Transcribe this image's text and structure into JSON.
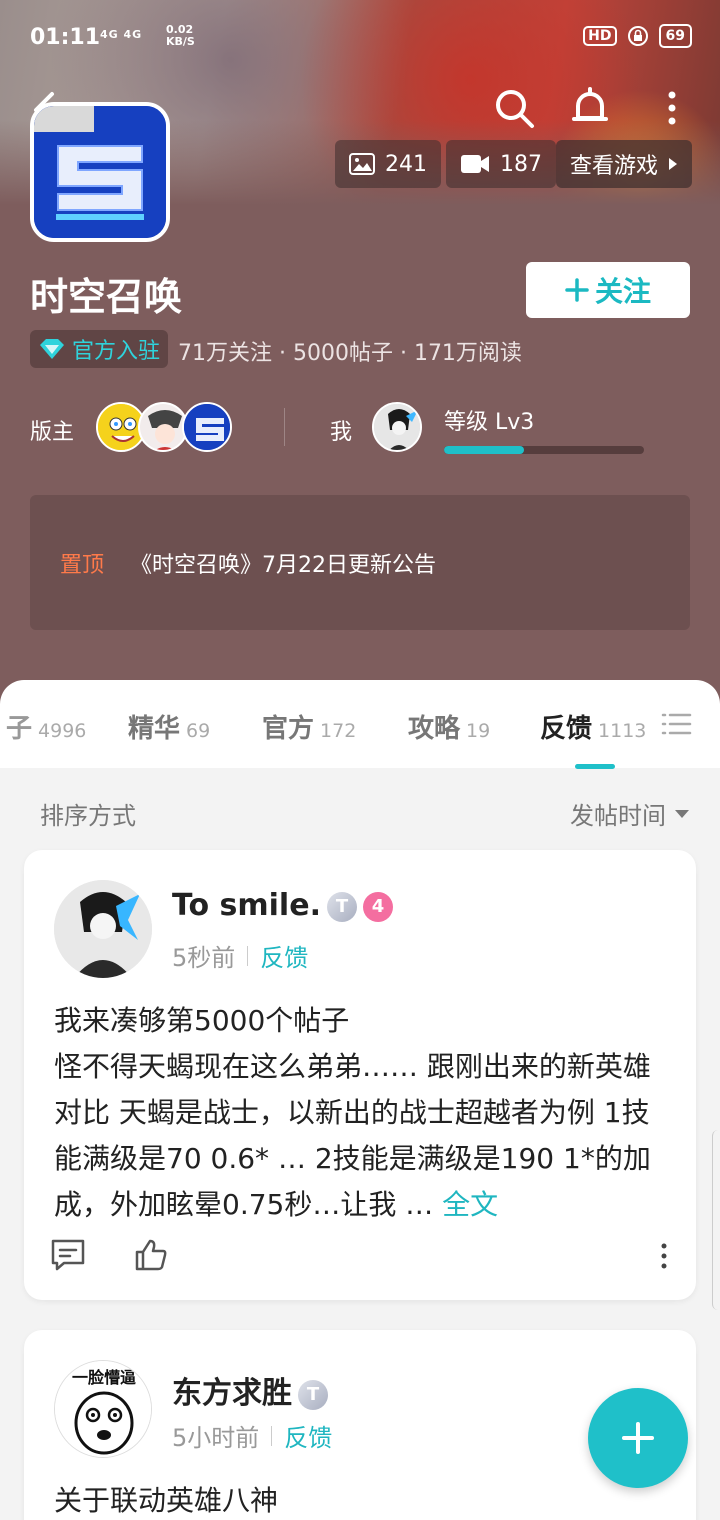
{
  "status_bar": {
    "time": "01:11",
    "network": "4G 4G",
    "speed_value": "0.02",
    "speed_unit": "KB/S",
    "hd": "HD",
    "battery": "69"
  },
  "header": {
    "media": {
      "images_count": "241",
      "videos_count": "187",
      "view_game_label": "查看游戏"
    },
    "game_title": "时空召唤",
    "follow_label": "关注",
    "official_badge": "官方入驻",
    "stats": "71万关注 · 5000帖子 · 171万阅读",
    "moderators_label": "版主",
    "me_label": "我",
    "level_label": "等级 Lv3",
    "level_progress": 0.4,
    "pinned": {
      "tag": "置顶",
      "text": "《时空召唤》7月22日更新公告"
    }
  },
  "tabs": [
    {
      "name": "子",
      "count": "4996"
    },
    {
      "name": "精华",
      "count": "69"
    },
    {
      "name": "官方",
      "count": "172"
    },
    {
      "name": "攻略",
      "count": "19"
    },
    {
      "name": "反馈",
      "count": "1113",
      "active": true
    }
  ],
  "sort": {
    "label": "排序方式",
    "value": "发帖时间"
  },
  "posts": [
    {
      "username": "To smile.",
      "badge_t": "T",
      "badge_level": "4",
      "time": "5秒前",
      "category": "反馈",
      "line1": "我来凑够第5000个帖子",
      "line2": "怪不得天蝎现在这么弟弟…… 跟刚出来的新英雄对比 天蝎是战士，以新出的战士超越者为例 1技能满级是70 0.6* … 2技能是满级是190 1*的加成，外加眩晕0.75秒…让我 …",
      "more": "全文"
    },
    {
      "username": "东方求胜",
      "badge_t": "T",
      "time": "5小时前",
      "category": "反馈",
      "line1": "关于联动英雄八神"
    }
  ],
  "colors": {
    "accent": "#1fc0c9",
    "header_bg": "#7e5d5d",
    "pin_tag": "#ff7a4a"
  }
}
